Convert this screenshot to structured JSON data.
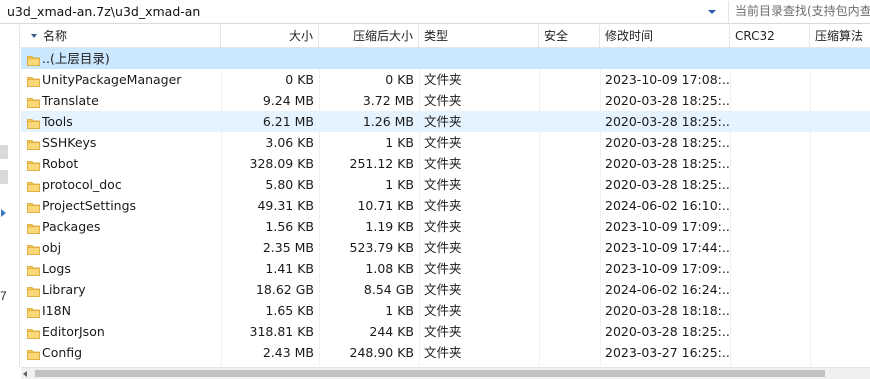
{
  "pathbar": {
    "path": "u3d_xmad-an.7z\\u3d_xmad-an",
    "search_placeholder": "当前目录查找(支持包内查"
  },
  "gutter": {
    "number": "7"
  },
  "columns": {
    "name": "名称",
    "size": "大小",
    "packed": "压缩后大小",
    "type": "类型",
    "security": "安全",
    "modified": "修改时间",
    "crc": "CRC32",
    "method": "压缩算法"
  },
  "rows": [
    {
      "name": "..(上层目录)",
      "size": "",
      "packed": "",
      "type": "",
      "modified": ""
    },
    {
      "name": "UnityPackageManager",
      "size": "0 KB",
      "packed": "0 KB",
      "type": "文件夹",
      "modified": "2023-10-09 17:08:..."
    },
    {
      "name": "Translate",
      "size": "9.24 MB",
      "packed": "3.72 MB",
      "type": "文件夹",
      "modified": "2020-03-28 18:25:..."
    },
    {
      "name": "Tools",
      "size": "6.21 MB",
      "packed": "1.26 MB",
      "type": "文件夹",
      "modified": "2020-03-28 18:25:..."
    },
    {
      "name": "SSHKeys",
      "size": "3.06 KB",
      "packed": "1 KB",
      "type": "文件夹",
      "modified": "2020-03-28 18:25:..."
    },
    {
      "name": "Robot",
      "size": "328.09 KB",
      "packed": "251.12 KB",
      "type": "文件夹",
      "modified": "2020-03-28 18:25:..."
    },
    {
      "name": "protocol_doc",
      "size": "5.80 KB",
      "packed": "1 KB",
      "type": "文件夹",
      "modified": "2020-03-28 18:25:..."
    },
    {
      "name": "ProjectSettings",
      "size": "49.31 KB",
      "packed": "10.71 KB",
      "type": "文件夹",
      "modified": "2024-06-02 16:10:..."
    },
    {
      "name": "Packages",
      "size": "1.56 KB",
      "packed": "1.19 KB",
      "type": "文件夹",
      "modified": "2023-10-09 17:09:..."
    },
    {
      "name": "obj",
      "size": "2.35 MB",
      "packed": "523.79 KB",
      "type": "文件夹",
      "modified": "2023-10-09 17:44:..."
    },
    {
      "name": "Logs",
      "size": "1.41 KB",
      "packed": "1.08 KB",
      "type": "文件夹",
      "modified": "2023-10-09 17:09:..."
    },
    {
      "name": "Library",
      "size": "18.62 GB",
      "packed": "8.54 GB",
      "type": "文件夹",
      "modified": "2024-06-02 16:24:..."
    },
    {
      "name": "I18N",
      "size": "1.65 KB",
      "packed": "1 KB",
      "type": "文件夹",
      "modified": "2020-03-28 18:18:..."
    },
    {
      "name": "EditorJson",
      "size": "318.81 KB",
      "packed": "244 KB",
      "type": "文件夹",
      "modified": "2020-03-28 18:25:..."
    },
    {
      "name": "Config",
      "size": "2.43 MB",
      "packed": "248.90 KB",
      "type": "文件夹",
      "modified": "2023-03-27 16:25:..."
    }
  ],
  "colors": {
    "selected_row": "#cce8ff",
    "hover_row": "#e5f3ff",
    "folder_yellow": "#f5c851",
    "folder_edge": "#d9a32e"
  },
  "icons": {
    "folder": "folder-icon",
    "dropdown": "chevron-down-icon",
    "sort": "sort-down-icon"
  }
}
